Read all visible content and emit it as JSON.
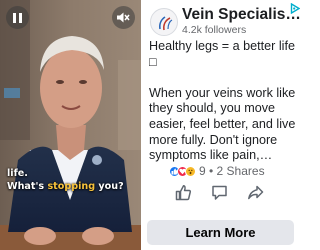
{
  "video": {
    "caption_line1": "life.",
    "caption_prefix": "What's ",
    "caption_highlight": "stopping",
    "caption_suffix": " you?",
    "controls": {
      "pause_icon": "pause-icon",
      "mute_icon": "muted-speaker-icon"
    }
  },
  "ad": {
    "page_name": "Vein Specialis…",
    "followers": "4.2k followers",
    "body_line1": "Healthy legs = a better life",
    "body_emoji": "□",
    "body_para2": "When your veins work like they should, you move easier, feel better, and live more fully. Don't ignore symptoms like pain,…",
    "reaction_count": "9 • 2 Shares",
    "reaction_icons": [
      "like-reaction-icon",
      "love-reaction-icon",
      "wow-reaction-icon"
    ],
    "cta_label": "Learn More"
  },
  "colors": {
    "accent_blue": "#1877f2",
    "caption_highlight": "#f7c23b",
    "button_bg": "#e4e6eb",
    "muted_text": "#65676b"
  }
}
